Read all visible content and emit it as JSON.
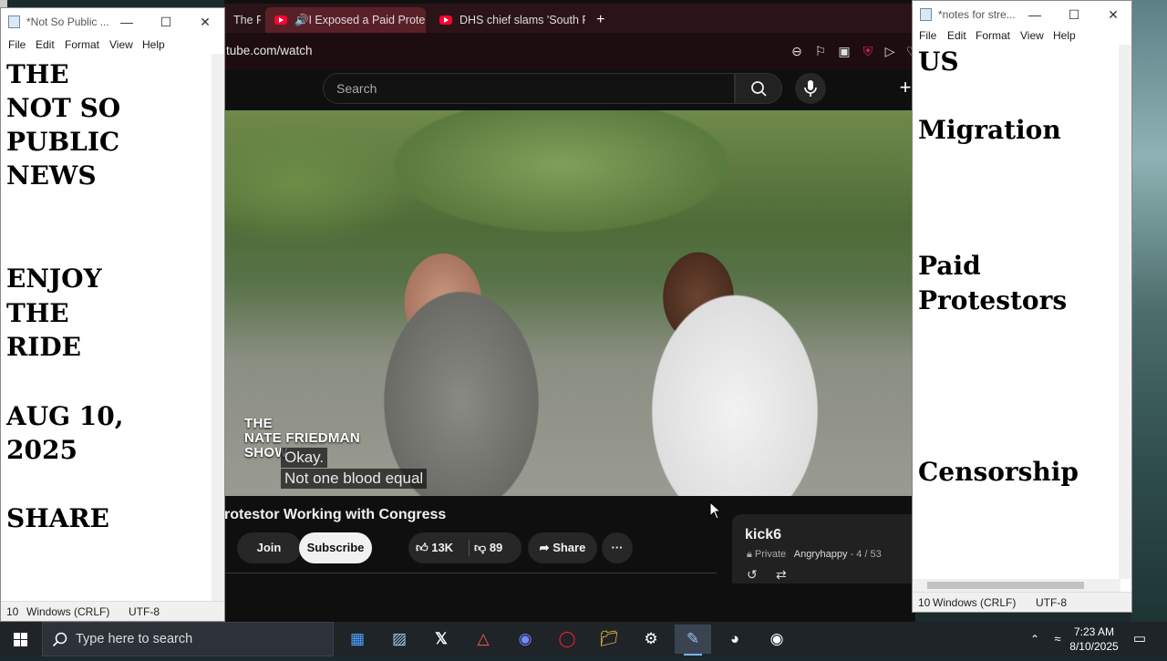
{
  "browser": {
    "tabs": [
      {
        "label": "The R"
      },
      {
        "label": "I Exposed a Paid Prote",
        "active": true
      },
      {
        "label": "DHS chief slams 'South P"
      }
    ],
    "new_tab": "+",
    "url": "tube.com/watch",
    "search_placeholder": "Search"
  },
  "video": {
    "watermark": "THE\nNATE FRIEDMAN\nSHOW",
    "watermark_line1": "THE",
    "watermark_line2": "NATE FRIEDMAN",
    "watermark_line3": "SHOW",
    "caption_line1": "Okay.",
    "caption_line2": "Not one blood equal",
    "title": "rotestor Working with Congress",
    "join_label": "Join",
    "subscribe_label": "Subscribe",
    "likes": "13K",
    "dislikes": "89",
    "share_label": "Share",
    "more_label": "···"
  },
  "playlist": {
    "title": "kick6",
    "privacy": "Private",
    "owner": "Angryhappy",
    "position": "- 4 / 53"
  },
  "notepad_left": {
    "title": "*Not So Public ...",
    "menu": [
      "File",
      "Edit",
      "Format",
      "View",
      "Help"
    ],
    "lines": [
      "THE",
      "NOT SO",
      "PUBLIC",
      "NEWS",
      "ENJOY",
      "THE",
      "RIDE",
      "AUG 10,",
      "2025",
      "SHARE"
    ],
    "status_pos": "10",
    "status_eol": "Windows (CRLF)",
    "status_enc": "UTF-8"
  },
  "notepad_right": {
    "title": "*notes for stre...",
    "menu": [
      "File",
      "Edit",
      "Format",
      "View",
      "Help"
    ],
    "lines": [
      "US",
      "Migration",
      "Paid",
      "Protestors",
      "Censorship"
    ],
    "status_pos": "10",
    "status_eol": "Windows (CRLF)",
    "status_enc": "UTF-8"
  },
  "taskbar": {
    "search_placeholder": "Type here to search",
    "time": "7:23 AM",
    "date": "8/10/2025"
  },
  "colors": {
    "tab_strip": "#2b1418",
    "active_tab": "#5a2028",
    "youtube_red": "#ff0033",
    "taskbar": "#1f2429"
  }
}
